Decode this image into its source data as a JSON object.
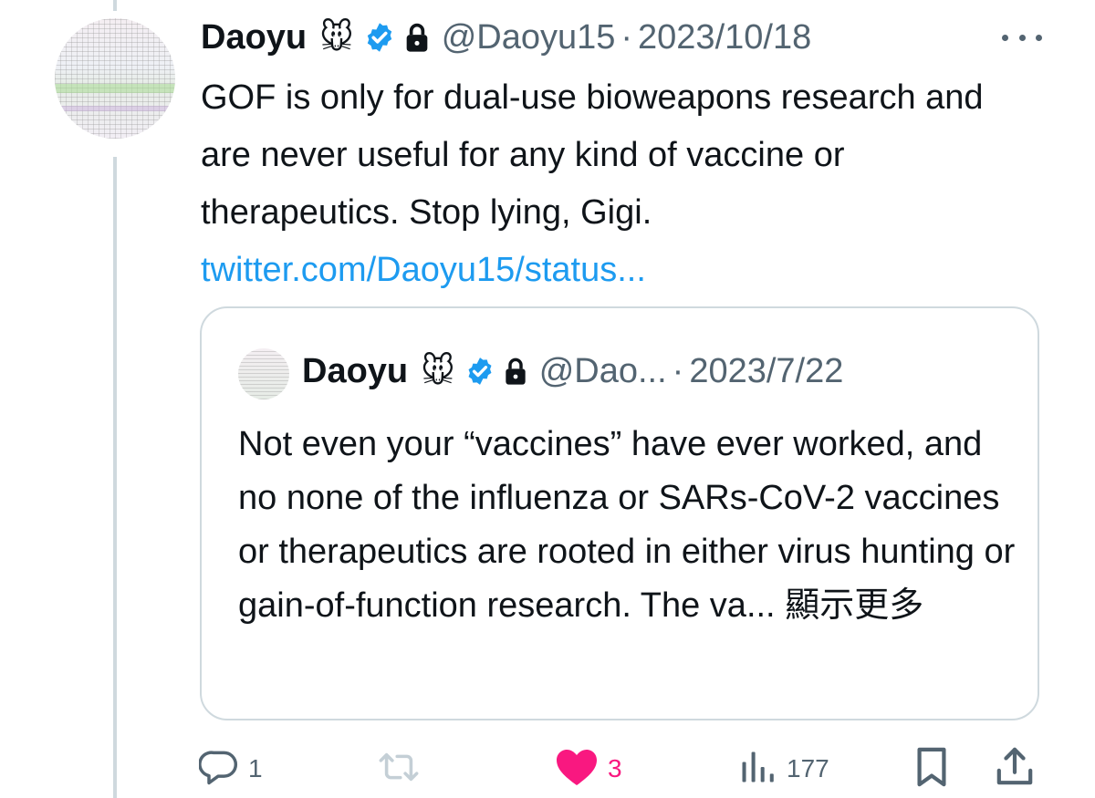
{
  "tweet": {
    "author_name": "Daoyu",
    "author_emoji": "🐭",
    "handle": "@Daoyu15",
    "separator": "·",
    "date": "2023/10/18",
    "text": "GOF is only for dual-use bioweapons research and are never useful for any kind of vaccine or therapeutics. Stop lying, Gigi.",
    "link": "twitter.com/Daoyu15/status..."
  },
  "quote": {
    "author_name": "Daoyu",
    "author_emoji": "🐭",
    "handle": "@Dao...",
    "separator": "·",
    "date": "2023/7/22",
    "text": "Not even your “vaccines” have ever worked, and no none of the influenza or SARs-CoV-2 vaccines or therapeutics are rooted in either virus hunting or gain-of-function research. The va...",
    "show_more": "顯示更多"
  },
  "actions": {
    "reply_count": "1",
    "retweet_count": "",
    "like_count": "3",
    "view_count": "177"
  },
  "colors": {
    "link": "#1d9bf0",
    "secondary_text": "#536471",
    "like": "#f91880",
    "verified": "#1d9bf0",
    "border": "#cfd9de"
  },
  "icons": [
    "verified-badge-icon",
    "lock-icon",
    "more-icon",
    "reply-icon",
    "retweet-icon",
    "like-icon",
    "views-icon",
    "bookmark-icon",
    "share-icon"
  ]
}
